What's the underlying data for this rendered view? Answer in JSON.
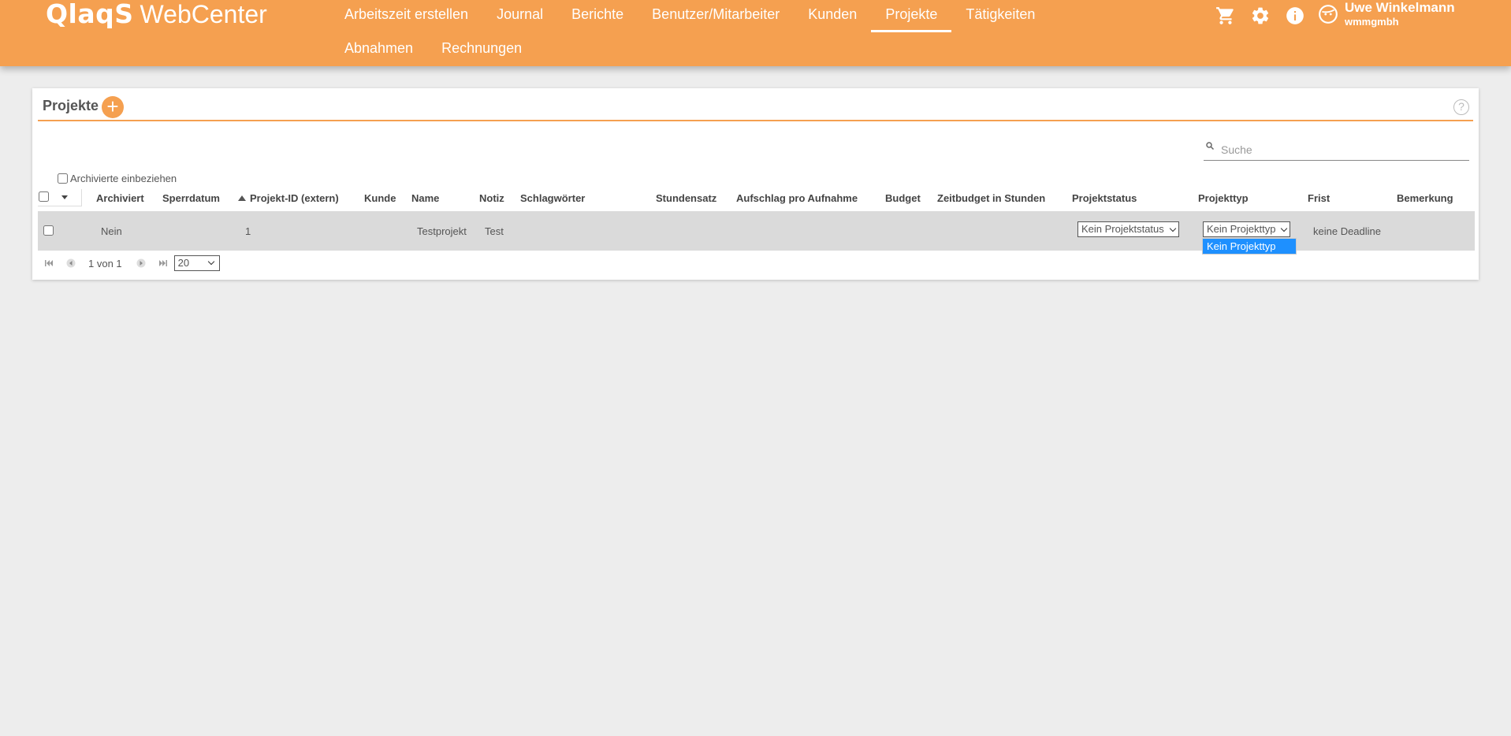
{
  "app": {
    "logo_brand": "QlaqS",
    "logo_product": "WebCenter"
  },
  "nav": {
    "row1": [
      {
        "label": "Arbeitszeit erstellen"
      },
      {
        "label": "Journal"
      },
      {
        "label": "Berichte"
      },
      {
        "label": "Benutzer/Mitarbeiter"
      },
      {
        "label": "Kunden"
      },
      {
        "label": "Projekte",
        "active": true
      },
      {
        "label": "Tätigkeiten"
      }
    ],
    "row2": [
      {
        "label": "Abnahmen"
      },
      {
        "label": "Rechnungen"
      }
    ]
  },
  "header_icons": [
    "cart-icon",
    "gear-icon",
    "info-icon",
    "user-face-icon"
  ],
  "user": {
    "name": "Uwe Winkelmann",
    "org": "wmmgmbh"
  },
  "page": {
    "title": "Projekte",
    "add_label": "+",
    "help_label": "?",
    "search_placeholder": "Suche",
    "archived_label": "Archivierte einbeziehen"
  },
  "table": {
    "columns": {
      "archiviert": "Archiviert",
      "sperrdatum": "Sperrdatum",
      "projekt_id": "Projekt-ID (extern)",
      "kunde": "Kunde",
      "name": "Name",
      "notiz": "Notiz",
      "schlagwoerter": "Schlagwörter",
      "stundensatz": "Stundensatz",
      "aufschlag": "Aufschlag pro Aufnahme",
      "budget": "Budget",
      "zeitbudget": "Zeitbudget in Stunden",
      "projektstatus": "Projektstatus",
      "projekttyp": "Projekttyp",
      "frist": "Frist",
      "bemerkung": "Bemerkung"
    },
    "rows": [
      {
        "archiviert": "Nein",
        "projekt_id": "1",
        "name": "Testprojekt",
        "notiz": "Test",
        "projektstatus": "Kein Projektstatus",
        "projekttyp": "Kein Projekttyp",
        "frist": "keine Deadline"
      }
    ],
    "projekttyp_options": [
      "Kein Projekttyp"
    ]
  },
  "pager": {
    "text": "1 von 1",
    "page_size": "20"
  },
  "colors": {
    "brand": "#f5a050",
    "highlight": "#1e90ff"
  }
}
